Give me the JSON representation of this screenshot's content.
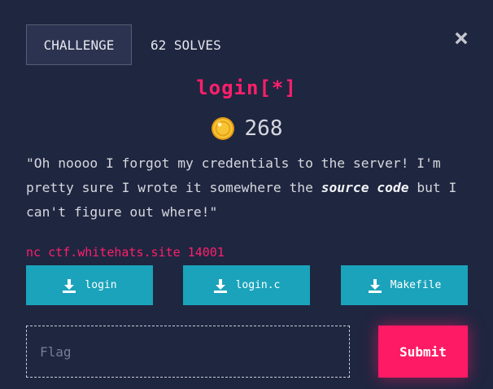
{
  "tabs": {
    "challenge": "CHALLENGE",
    "solves": "62 SOLVES"
  },
  "close": {
    "icon": "close-icon",
    "glyph": "✖"
  },
  "challenge": {
    "title": "login[*]",
    "points": "268",
    "points_icon": "coin-icon",
    "description_pre": "\"Oh noooo I forgot my credentials to the server! I'm pretty sure I wrote it somewhere the ",
    "description_emph": "source code",
    "description_post": " but I can't figure out where!\"",
    "connection": "nc ctf.whitehats.site 14001"
  },
  "files": [
    {
      "label": "login",
      "icon": "download-icon"
    },
    {
      "label": "login.c",
      "icon": "download-icon"
    },
    {
      "label": "Makefile",
      "icon": "download-icon"
    }
  ],
  "flag_form": {
    "placeholder": "Flag",
    "value": "",
    "submit_label": "Submit"
  },
  "colors": {
    "background": "#1f2640",
    "accent_pink": "#ff1f6b",
    "file_button": "#1aa3bb",
    "submit_button": "#ff1a66"
  }
}
